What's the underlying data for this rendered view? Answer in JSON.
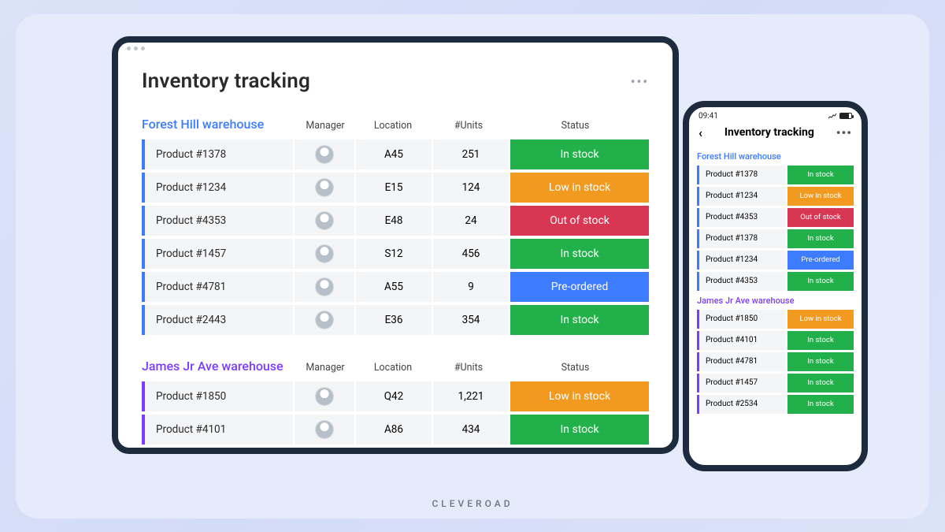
{
  "brand": "CLEVEROAD",
  "page_title": "Inventory tracking",
  "more_glyph": "•••",
  "columns": {
    "manager": "Manager",
    "location": "Location",
    "units": "#Units",
    "status": "Status"
  },
  "status_colors": {
    "In stock": "#22b04a",
    "Low in stock": "#f19a1f",
    "Out of stock": "#d73752",
    "Pre-ordered": "#3d7bff"
  },
  "tablet": {
    "warehouses": [
      {
        "name": "Forest Hill warehouse",
        "accent": "blue",
        "rows": [
          {
            "product": "Product  #1378",
            "location": "A45",
            "units": "251",
            "status": "In stock"
          },
          {
            "product": "Product  #1234",
            "location": "E15",
            "units": "124",
            "status": "Low in stock"
          },
          {
            "product": "Product  #4353",
            "location": "E48",
            "units": "24",
            "status": "Out of stock"
          },
          {
            "product": "Product  #1457",
            "location": "S12",
            "units": "456",
            "status": "In stock"
          },
          {
            "product": "Product  #4781",
            "location": "A55",
            "units": "9",
            "status": "Pre-ordered"
          },
          {
            "product": "Product  #2443",
            "location": "E36",
            "units": "354",
            "status": "In stock"
          }
        ]
      },
      {
        "name": "James Jr Ave warehouse",
        "accent": "purple",
        "rows": [
          {
            "product": "Product  #1850",
            "location": "Q42",
            "units": "1,221",
            "status": "Low in stock"
          },
          {
            "product": "Product  #4101",
            "location": "A86",
            "units": "434",
            "status": "In stock"
          }
        ]
      }
    ]
  },
  "phone": {
    "time": "09:41",
    "title": "Inventory tracking",
    "warehouses": [
      {
        "name": "Forest Hill warehouse",
        "accent": "blue",
        "rows": [
          {
            "product": "Product #1378",
            "status": "In stock"
          },
          {
            "product": "Product #1234",
            "status": "Low in stock"
          },
          {
            "product": "Product #4353",
            "status": "Out of stock"
          },
          {
            "product": "Product #1378",
            "status": "In stock"
          },
          {
            "product": "Product #1234",
            "status": "Pre-ordered"
          },
          {
            "product": "Product #4353",
            "status": "In stock"
          }
        ]
      },
      {
        "name": "James Jr Ave warehouse",
        "accent": "purple",
        "rows": [
          {
            "product": "Product #1850",
            "status": "Low in stock"
          },
          {
            "product": "Product #4101",
            "status": "In stock"
          },
          {
            "product": "Product #4781",
            "status": "In stock"
          },
          {
            "product": "Product #1457",
            "status": "In stock"
          },
          {
            "product": "Product #2534",
            "status": "In stock"
          }
        ]
      }
    ]
  }
}
